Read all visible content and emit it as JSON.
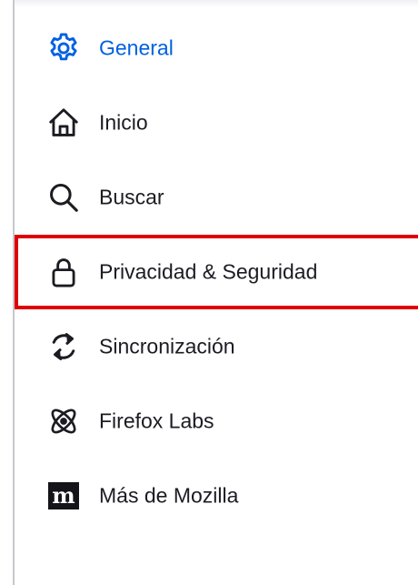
{
  "sidebar": {
    "items": [
      {
        "label": "General",
        "icon": "gear-icon",
        "active": true
      },
      {
        "label": "Inicio",
        "icon": "home-icon",
        "active": false
      },
      {
        "label": "Buscar",
        "icon": "search-icon",
        "active": false
      },
      {
        "label": "Privacidad & Seguridad",
        "icon": "lock-icon",
        "active": false,
        "highlighted": true
      },
      {
        "label": "Sincronización",
        "icon": "sync-icon",
        "active": false
      },
      {
        "label": "Firefox Labs",
        "icon": "atom-icon",
        "active": false
      },
      {
        "label": "Más de Mozilla",
        "icon": "mozilla-icon",
        "icon_text": "m",
        "active": false
      }
    ]
  },
  "colors": {
    "active": "#0061e0",
    "text": "#1c1b22",
    "highlight_border": "#e00000"
  }
}
